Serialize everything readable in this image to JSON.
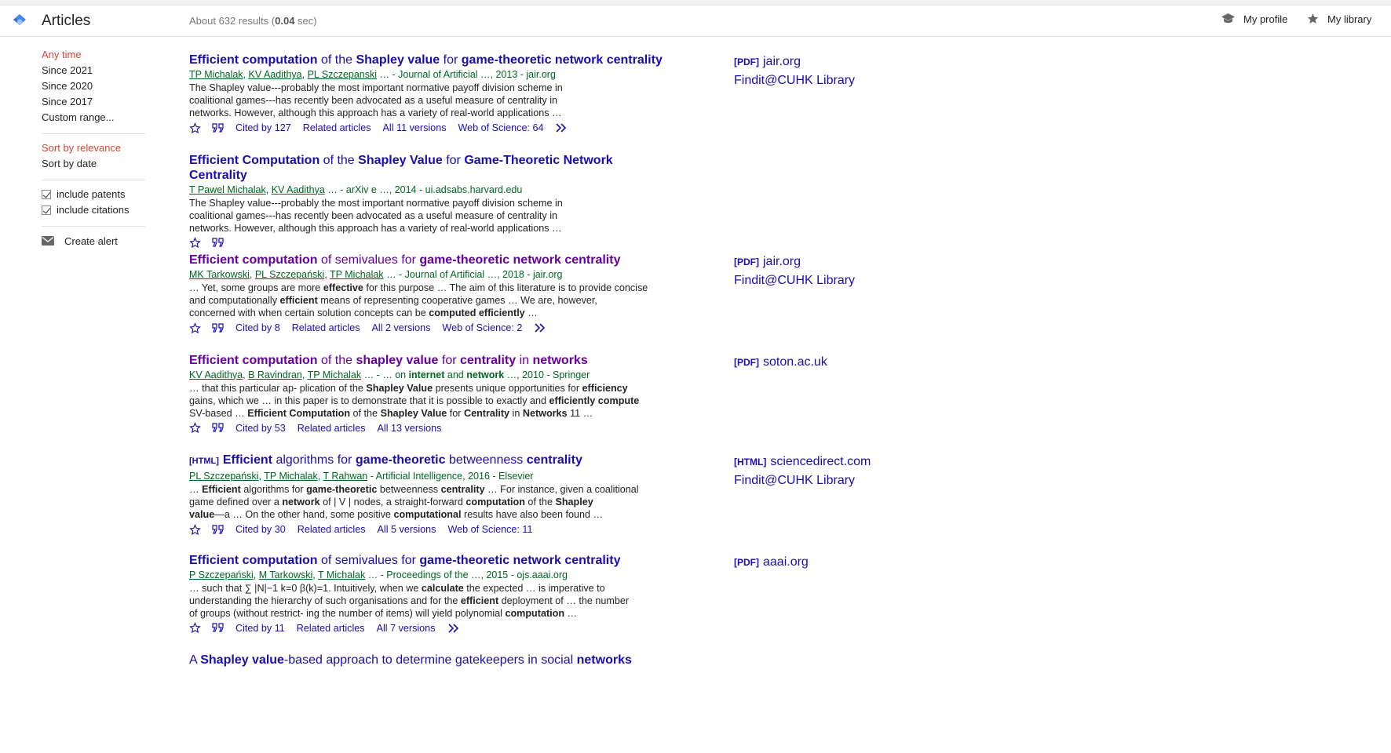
{
  "header": {
    "title": "Articles",
    "results_prefix": "About 632 results (",
    "results_time": "0.04",
    "results_suffix": " sec)",
    "my_profile": "My profile",
    "my_library": "My library"
  },
  "sidebar": {
    "time_filters": [
      "Any time",
      "Since 2021",
      "Since 2020",
      "Since 2017",
      "Custom range..."
    ],
    "sort_options": [
      "Sort by relevance",
      "Sort by date"
    ],
    "checkboxes": [
      "include patents",
      "include citations"
    ],
    "create_alert": "Create alert"
  },
  "results": [
    {
      "title_html": "<b>Efficient computation</b> of the <b>Shapley value</b> for <b>game-theoretic network centrality</b>",
      "visited": false,
      "authors": [
        "TP Michalak",
        "KV Aadithya",
        "PL Szczepanski"
      ],
      "source": "… - Journal of Artificial …, 2013 - jair.org",
      "snippet_html": "The Shapley value---probably the most important normative payoff division scheme in<br>coalitional games---has recently been advocated as a useful measure of centrality in<br>networks. However, although this approach has a variety of real-world applications …",
      "actions": [
        "Cited by 127",
        "Related articles",
        "All 11 versions",
        "Web of Science: 64"
      ],
      "more": true,
      "side": [
        {
          "tag": "[PDF]",
          "text": "jair.org"
        },
        {
          "tag": "",
          "text": "Findit@CUHK Library"
        }
      ]
    },
    {
      "title_html": "<b>Efficient Computation</b> of the <b>Shapley Value</b> for <b>Game-Theoretic Network Centrality</b>",
      "visited": false,
      "authors": [
        "T Pawel Michalak",
        "KV Aadithya"
      ],
      "source": "… - arXiv e …, 2014 - ui.adsabs.harvard.edu",
      "snippet_html": "The Shapley value---probably the most important normative payoff division scheme in<br>coalitional games---has recently been advocated as a useful measure of centrality in<br>networks. However, although this approach has a variety of real-world applications …",
      "actions": [],
      "more": false,
      "side": []
    },
    {
      "title_html": "<b>Efficient computation</b> of semivalues for <b>game-theoretic network centrality</b>",
      "visited": true,
      "authors": [
        "MK Tarkowski",
        "PL Szczepański",
        "TP Michalak"
      ],
      "source": "… - Journal of Artificial …, 2018 - jair.org",
      "snippet_html": "… Yet, some groups are more <b>effective</b> for this purpose … The aim of this literature is to provide concise<br>and computationally <b>efficient</b> means of representing cooperative games … We are, however,<br>concerned with when certain solution concepts can be <b>computed efficiently</b> …",
      "actions": [
        "Cited by 8",
        "Related articles",
        "All 2 versions",
        "Web of Science: 2"
      ],
      "more": true,
      "side": [
        {
          "tag": "[PDF]",
          "text": "jair.org"
        },
        {
          "tag": "",
          "text": "Findit@CUHK Library"
        }
      ]
    },
    {
      "title_html": "<b>Efficient computation</b> of the <b>shapley value</b> for <b>centrality</b> in <b>networks</b>",
      "visited": true,
      "authors": [
        "KV Aadithya",
        "B Ravindran",
        "TP Michalak"
      ],
      "source": "… - … on <b>internet</b> and <b>network</b> …, 2010 - Springer",
      "snippet_html": "… that this particular ap- plication of the <b>Shapley Value</b> presents unique opportunities for <b>efficiency</b><br>gains, which we … in this paper is to demonstrate that it is possible to exactly and <b>efficiently compute</b><br>SV-based … <b>Efficient Computation</b> of the <b>Shapley Value</b> for <b>Centrality</b> in <b>Networks</b> 11 …",
      "actions": [
        "Cited by 53",
        "Related articles",
        "All 13 versions"
      ],
      "more": false,
      "side": [
        {
          "tag": "[PDF]",
          "text": "soton.ac.uk"
        }
      ]
    },
    {
      "title_tag": "[HTML]",
      "title_html": "<b>Efficient</b> algorithms for <b>game-theoretic</b> betweenness <b>centrality</b>",
      "visited": false,
      "authors": [
        "PL Szczepański",
        "TP Michalak",
        "T Rahwan"
      ],
      "source": "- Artificial Intelligence, 2016 - Elsevier",
      "snippet_html": "… <b>Efficient</b> algorithms for <b>game-theoretic</b> betweenness <b>centrality</b> … For instance, given a coalitional<br>game defined over a <b>network</b> of | V | nodes, a straight-forward <b>computation</b> of the <b>Shapley</b><br><b>value</b>—a … On the other hand, some positive <b>computational</b> results have also been found …",
      "actions": [
        "Cited by 30",
        "Related articles",
        "All 5 versions",
        "Web of Science: 11"
      ],
      "more": false,
      "side": [
        {
          "tag": "[HTML]",
          "text": "sciencedirect.com"
        },
        {
          "tag": "",
          "text": "Findit@CUHK Library"
        }
      ]
    },
    {
      "title_html": "<b>Efficient computation</b> of semivalues for <b>game-theoretic network centrality</b>",
      "visited": false,
      "authors": [
        "P Szczepański",
        "M Tarkowski",
        "T Michalak"
      ],
      "source": "… - Proceedings of the …, 2015 - ojs.aaai.org",
      "snippet_html": "… such that ∑ |N|−1 k=0 β(k)=1. Intuitively, when we <b>calculate</b> the expected … is imperative to<br>understanding the hierarchy of such organisations and for the <b>efficient</b> deployment of … the number<br>of groups (without restrict- ing the number of items) will yield polynomial <b>computation</b> …",
      "actions": [
        "Cited by 11",
        "Related articles",
        "All 7 versions"
      ],
      "more": true,
      "side": [
        {
          "tag": "[PDF]",
          "text": "aaai.org"
        }
      ]
    },
    {
      "title_html": "A <b>Shapley value</b>-based approach to determine gatekeepers in social <b>networks</b>",
      "visited": false,
      "authors": [],
      "source": "",
      "snippet_html": "",
      "actions": [],
      "more": false,
      "side": []
    }
  ],
  "icons": {
    "logo": "scholar-cap-icon",
    "profile": "graduation-cap-icon",
    "library": "star-icon",
    "save": "star-outline-icon",
    "cite": "quote-icon",
    "more": "double-chevron-icon",
    "alert": "envelope-icon"
  },
  "colors": {
    "link": "#1a0dab",
    "visited": "#660099",
    "green": "#006621",
    "active_filter": "#d14836"
  }
}
